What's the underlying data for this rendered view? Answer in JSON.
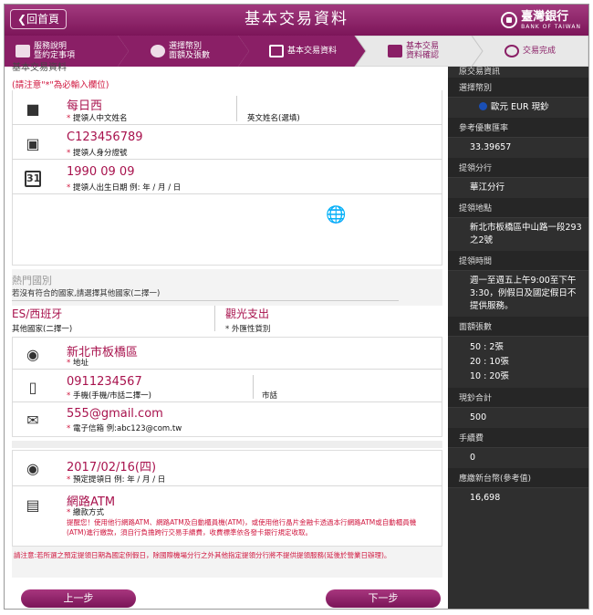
{
  "header": {
    "home_label": "❮回首頁",
    "title": "基本交易資料",
    "bank_name": "臺灣銀行",
    "bank_name_en": "BANK OF TAIWAN"
  },
  "steps": [
    {
      "label": "服務說明\n暨約定事項"
    },
    {
      "label": "選擇幣別\n面額及張數"
    },
    {
      "label": "基本交易資料"
    },
    {
      "label": "基本交易\n資料確認"
    },
    {
      "label": "交易完成"
    }
  ],
  "form": {
    "section_title": "基本交易資料",
    "required_note": "(請注意\"*\"為必輸入欄位)",
    "chinese_name": "每日西",
    "chinese_name_label": "提領人中文姓名",
    "english_name_label": "英文姓名(選填)",
    "id_number": "C123456789",
    "id_label": "提領人身分證號",
    "birth_year": "1990",
    "birth_month": "09",
    "birth_day": "09",
    "birth_label": "提領人出生日期 例: 年 / 月 / 日",
    "hot_country_title": "熱門國別",
    "hot_country_note": "若沒有符合的國家,請選擇其他國家(二擇一)",
    "country_value": "ES/西班牙",
    "country_label": "其他國家(二擇一)",
    "purpose_value": "觀光支出",
    "purpose_label": "外匯性質別",
    "address": "新北市板橋區",
    "address_label": "地址",
    "phone": "0911234567",
    "phone_label": "手機(手機/市話二擇一)",
    "landline_label": "市話",
    "email": "555@gmail.com",
    "email_label": "電子信箱 例:abc123@com.tw",
    "pickup_date": "2017/02/16(四)",
    "pickup_date_label": "預定提領日 例: 年 / 月 / 日",
    "payment": "網路ATM",
    "payment_label": "繳款方式",
    "payment_warning": "提醒您！使用他行網路ATM、網路ATM及自動櫃員機(ATM)，或使用他行晶片金融卡透過本行網路ATM或自動櫃員機(ATM)進行繳款，須自行負擔跨行交易手續費，收費標準依各發卡銀行規定收取。",
    "footer_note": "請注意:若所選之預定提領日期為國定例假日，除國際機場分行之外其他指定提領分行將不提供提領服務(延後於營業日辦理)。",
    "prev_button": "上一步",
    "next_button": "下一步"
  },
  "sidebar": {
    "title": "原交易資訊",
    "currency_label": "選擇幣別",
    "currency_value": "歐元 EUR 現鈔",
    "rate_label": "參考優惠匯率",
    "rate_value": "33.39657",
    "branch_label": "提領分行",
    "branch_value": "華江分行",
    "location_label": "提領地點",
    "location_value": "新北市板橋區中山路一段293之2號",
    "hours_label": "提領時間",
    "hours_value": "週一至週五上午9:00至下午3:30，例假日及國定假日不提供服務。",
    "denom_label": "面額張數",
    "denoms": [
      "50 : 2張",
      "20 : 10張",
      "10 : 20張"
    ],
    "total_label": "現鈔合計",
    "total_value": "500",
    "fee_label": "手續費",
    "fee_value": "0",
    "twd_label": "應繳新台幣(參考值)",
    "twd_value": "16,698"
  },
  "colors": {
    "brand": "#8a1f66",
    "value_text": "#a8124d",
    "required": "#d0163e",
    "sidebar": "#2f2f2f"
  }
}
